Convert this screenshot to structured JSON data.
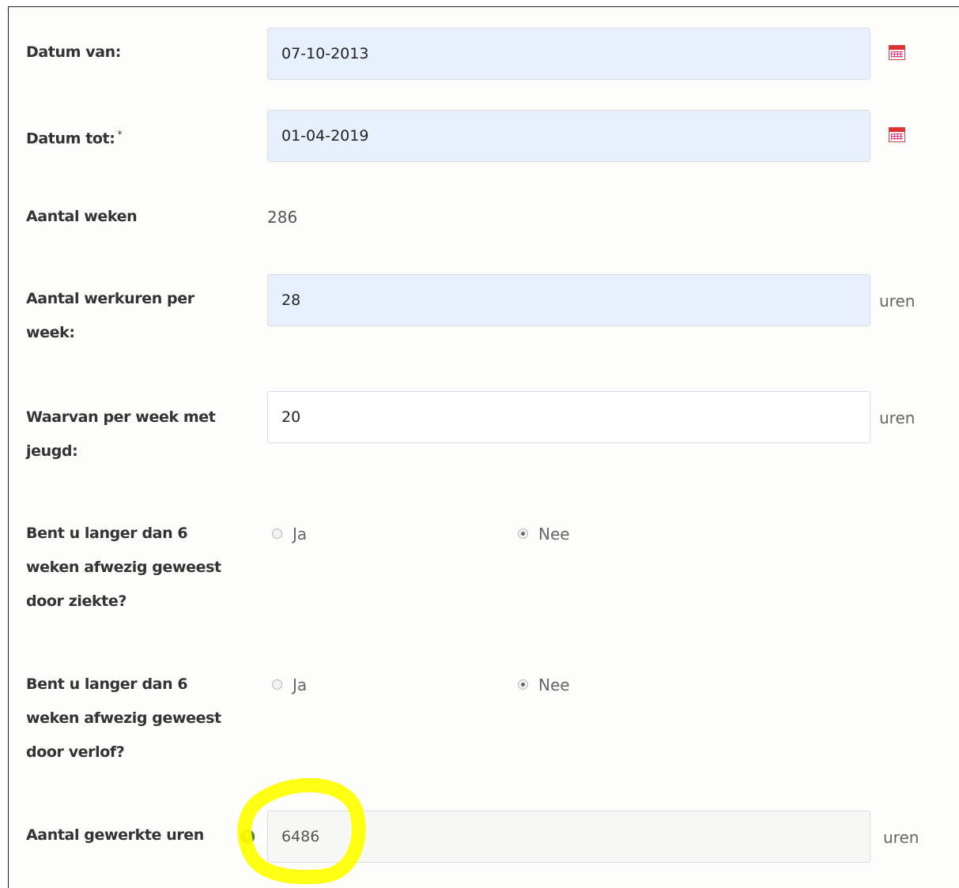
{
  "form": {
    "datum_van": {
      "label": "Datum van:",
      "value": "07-10-2013"
    },
    "datum_tot": {
      "label": "Datum tot:",
      "required_mark": "*",
      "value": "01-04-2019"
    },
    "aantal_weken": {
      "label": "Aantal weken",
      "value": "286"
    },
    "werkuren": {
      "label": "Aantal werkuren per week:",
      "value": "28",
      "unit": "uren"
    },
    "jeugd": {
      "label": "Waarvan per week met jeugd:",
      "value": "20",
      "unit": "uren"
    },
    "ziekte": {
      "label": "Bent u langer dan 6 weken afwezig geweest door ziekte?",
      "options": [
        "Ja",
        "Nee"
      ],
      "selected": "Nee"
    },
    "verlof": {
      "label": "Bent u langer dan 6 weken afwezig geweest door verlof?",
      "options": [
        "Ja",
        "Nee"
      ],
      "selected": "Nee"
    },
    "gewerkte_uren": {
      "label": "Aantal gewerkte uren",
      "value": "6486",
      "unit": "uren"
    }
  },
  "icons": {
    "calendar": "calendar-icon",
    "info": "info-icon"
  },
  "colors": {
    "autofill_bg": "#e8f0fe",
    "highlight": "#ffff00"
  }
}
